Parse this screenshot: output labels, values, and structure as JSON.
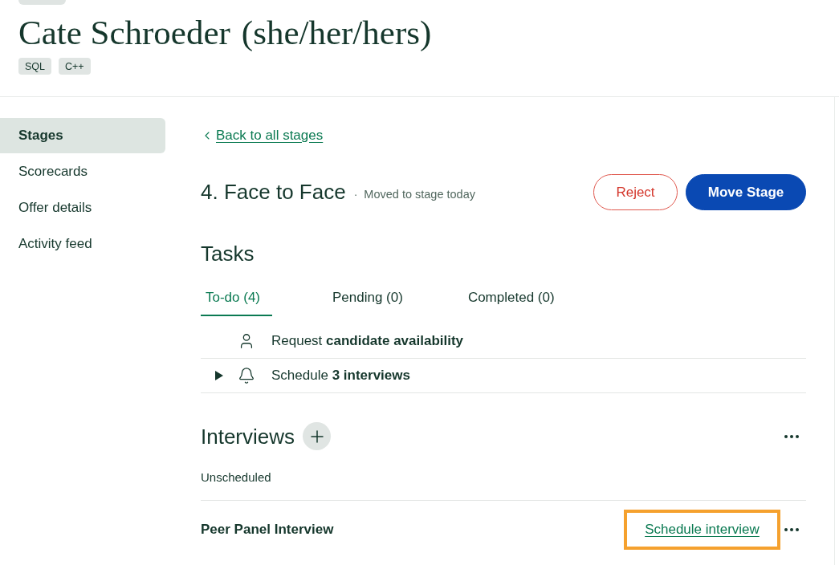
{
  "candidate": {
    "name": "Cate Schroeder",
    "pronouns": "(she/her/hers)",
    "tags": [
      "SQL",
      "C++"
    ]
  },
  "sidebar": {
    "items": [
      {
        "label": "Stages",
        "selected": true
      },
      {
        "label": "Scorecards",
        "selected": false
      },
      {
        "label": "Offer details",
        "selected": false
      },
      {
        "label": "Activity feed",
        "selected": false
      }
    ]
  },
  "stage": {
    "back_link": "Back to all stages",
    "title": "4. Face to Face",
    "separator": "·",
    "status": "Moved to stage today",
    "buttons": [
      {
        "label": "Reject",
        "kind": "outline"
      },
      {
        "label": "Move Stage",
        "kind": "primary"
      }
    ]
  },
  "tasks": {
    "title": "Tasks",
    "tabs": [
      {
        "label": "To-do (4)",
        "selected": true
      },
      {
        "label": "Pending (0)",
        "selected": false
      },
      {
        "label": "Completed (0)",
        "selected": false
      }
    ],
    "items": [
      {
        "kind": "person",
        "text": "Request **candidate availability**"
      },
      {
        "kind": "bell",
        "text": "Schedule **3 interviews**",
        "expanded": false
      }
    ]
  },
  "interviews": {
    "title": "Interviews",
    "group": "Unscheduled",
    "items": [
      {
        "name": "Peer Panel Interview",
        "action": "Schedule interview",
        "highlighted": true
      }
    ]
  }
}
